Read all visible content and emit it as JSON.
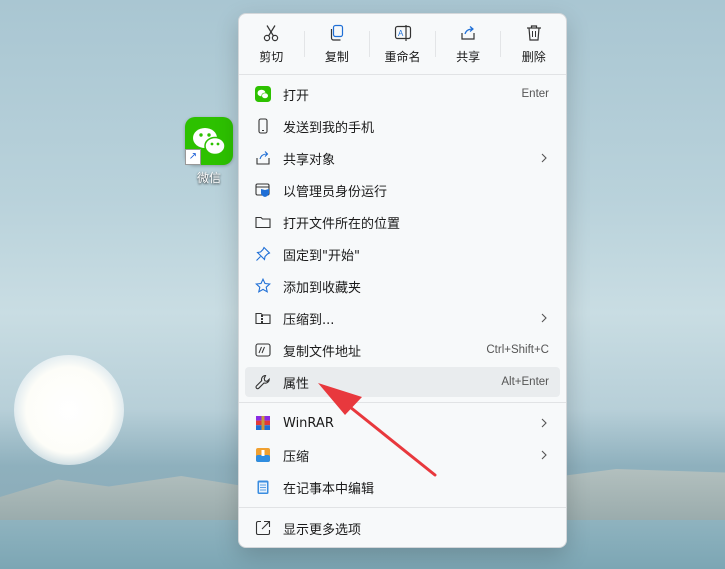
{
  "desktop": {
    "wechat_label": "微信"
  },
  "toolbar": {
    "cut": "剪切",
    "copy": "复制",
    "rename": "重命名",
    "share": "共享",
    "delete": "删除"
  },
  "menu": {
    "open": {
      "label": "打开",
      "shortcut": "Enter"
    },
    "send_to_phone": {
      "label": "发送到我的手机"
    },
    "share_object": {
      "label": "共享对象"
    },
    "run_as_admin": {
      "label": "以管理员身份运行"
    },
    "open_location": {
      "label": "打开文件所在的位置"
    },
    "pin_start": {
      "label": "固定到\"开始\""
    },
    "add_favorites": {
      "label": "添加到收藏夹"
    },
    "compress_to": {
      "label": "压缩到..."
    },
    "copy_path": {
      "label": "复制文件地址",
      "shortcut": "Ctrl+Shift+C"
    },
    "properties": {
      "label": "属性",
      "shortcut": "Alt+Enter"
    },
    "winrar": {
      "label": "WinRAR"
    },
    "compress": {
      "label": "压缩"
    },
    "notepad_edit": {
      "label": "在记事本中编辑"
    },
    "more_options": {
      "label": "显示更多选项"
    }
  },
  "colors": {
    "accent": "#1f6fd6",
    "wechat_green": "#2dc100",
    "arrow_red": "#e8383d"
  }
}
